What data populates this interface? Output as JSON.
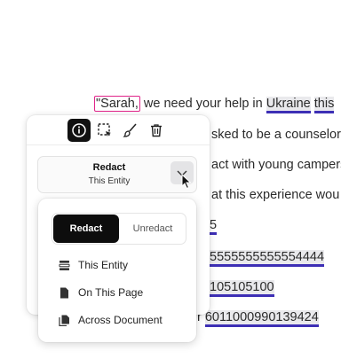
{
  "document": {
    "line1": {
      "highlight": "\"Sarah,",
      "middle": " we need your help in ",
      "link1": "Ukraine",
      "space": " ",
      "link2": "this"
    },
    "line2": "sked to be a counselor",
    "line3": "act with young campers",
    "line4": "at this experience wou",
    "line5": "5",
    "line6": "5555555555554444",
    "line7": "105105100",
    "line8_prefix": "r ",
    "line8_link": "6011000990139424"
  },
  "toolbar": {
    "icons": [
      "info-icon",
      "select-area-icon",
      "brush-icon",
      "trash-icon"
    ]
  },
  "dropdown": {
    "title": "Redact",
    "subtitle": "This Entity"
  },
  "popover": {
    "segment": {
      "active": "Redact",
      "inactive": "Unredact"
    },
    "items": [
      {
        "label": "This Entity",
        "icon": "stack-icon"
      },
      {
        "label": "On This Page",
        "icon": "page-icon"
      },
      {
        "label": "Across Document",
        "icon": "documents-icon"
      }
    ]
  },
  "colors": {
    "highlight_border": "#e0248a",
    "underline": "#3d2fb5",
    "active_bg": "#111111"
  }
}
